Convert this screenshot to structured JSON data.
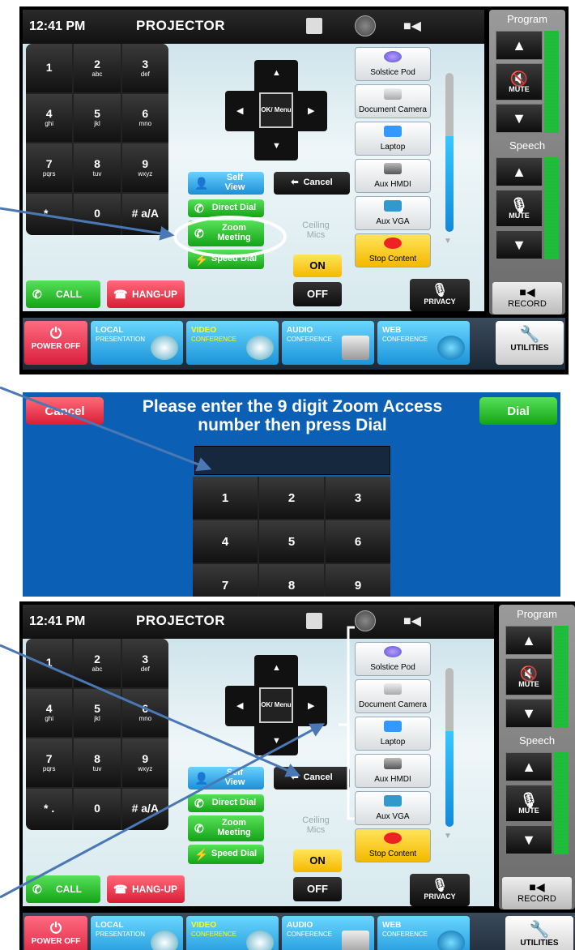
{
  "panel1": {
    "time": "12:41 PM",
    "title": "PROJECTOR",
    "keypad": [
      {
        "d": "1",
        "s": ""
      },
      {
        "d": "2",
        "s": "abc"
      },
      {
        "d": "3",
        "s": "def"
      },
      {
        "d": "4",
        "s": "ghi"
      },
      {
        "d": "5",
        "s": "jkl"
      },
      {
        "d": "6",
        "s": "mno"
      },
      {
        "d": "7",
        "s": "pqrs"
      },
      {
        "d": "8",
        "s": "tuv"
      },
      {
        "d": "9",
        "s": "wxyz"
      },
      {
        "d": "* .",
        "s": ""
      },
      {
        "d": "0",
        "s": ""
      },
      {
        "d": "# a/A",
        "s": ""
      }
    ],
    "dpad_center": "OK/ Menu",
    "self_view": "Self View",
    "cancel": "Cancel",
    "direct_dial": "Direct Dial",
    "zoom_meeting": "Zoom Meeting",
    "speed_dial": "Speed Dial",
    "ceiling_mics": "Ceiling Mics",
    "on": "ON",
    "off": "OFF",
    "privacy": "PRIVACY",
    "call": "CALL",
    "hang_up": "HANG-UP",
    "sources": [
      "Solstice Pod",
      "Document Camera",
      "Laptop",
      "Aux HMDI",
      "Aux VGA",
      "Stop Content"
    ],
    "program": "Program",
    "speech": "Speech",
    "mute": "MUTE",
    "record": "RECORD",
    "bottom": {
      "power": "POWER OFF",
      "local": "LOCAL",
      "local_sub": "PRESENTATION",
      "video": "VIDEO",
      "video_sub": "CONFERENCE",
      "audio": "AUDIO",
      "audio_sub": "CONFERENCE",
      "web": "WEB",
      "web_sub": "CONFERENCE",
      "utilities": "UTILITIES"
    }
  },
  "panel2": {
    "cancel": "Cancel",
    "dial": "Dial",
    "prompt": "Please enter the 9 digit Zoom Access number then press Dial",
    "keys": [
      "1",
      "2",
      "3",
      "4",
      "5",
      "6",
      "7",
      "8",
      "9"
    ]
  },
  "colors": {
    "accent_blue": "#1b8fd6",
    "green": "#13a415",
    "red": "#d91e36",
    "popup_bg": "#0b5fb4",
    "arrow": "#4a78b4"
  }
}
